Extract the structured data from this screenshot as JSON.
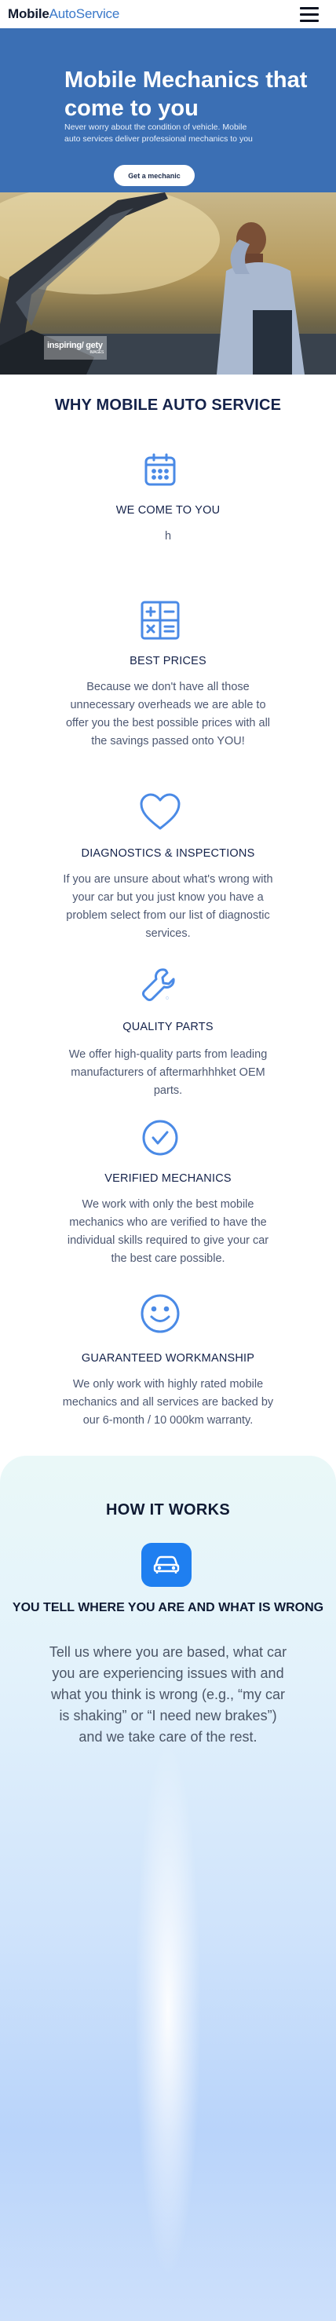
{
  "header": {
    "logo_part1": "Mobile",
    "logo_part2": "AutoService",
    "menu_icon": "hamburger-menu-icon"
  },
  "hero": {
    "title": "Mobile Mechanics that come to you",
    "subtitle": "Never worry about the condition of vehicle. Mobile auto services deliver professional mechanics to you",
    "cta_label": "Get a mechanic"
  },
  "photo": {
    "watermark_main": "inspiring/ gety",
    "watermark_sub": "IMAGES"
  },
  "why": {
    "title": "WHY MOBILE AUTO SERVICE",
    "features": [
      {
        "icon": "calendar-icon",
        "title": "WE COME TO YOU",
        "desc": "h"
      },
      {
        "icon": "calculator-icon",
        "title": "BEST PRICES",
        "desc": "Because we don't have all those unnecessary overheads we are able to offer you the best possible prices with all the savings passed onto YOU!"
      },
      {
        "icon": "heart-icon",
        "title": "DIAGNOSTICS & INSPECTIONS",
        "desc": "If you are unsure about what's wrong with your car but you just know you have a problem select from our list of diagnostic services."
      },
      {
        "icon": "wrench-icon",
        "title": "QUALITY PARTS",
        "desc": "We offer high-quality parts from leading manufacturers of aftermarhhhket OEM parts."
      },
      {
        "icon": "check-circle-icon",
        "title": "VERIFIED MECHANICS",
        "desc": "We work with only the best mobile mechanics who are verified to have the individual skills required to give your car the best care possible."
      },
      {
        "icon": "smile-icon",
        "title": "GUARANTEED WORKMANSHIP",
        "desc": "We only work with highly rated mobile mechanics and all services are backed by our 6-month / 10 000km warranty."
      }
    ]
  },
  "how": {
    "title": "HOW IT WORKS",
    "step_icon": "car-icon",
    "step_title": "YOU TELL WHERE YOU ARE AND WHAT IS WRONG",
    "step_desc": "Tell us where you are based, what car you are experiencing issues with and what you think is wrong (e.g., “my car is shaking” or “I need new brakes”) and we take care of the rest."
  },
  "colors": {
    "brand_blue": "#3b6fb4",
    "accent_blue": "#4a8ae6",
    "how_icon_bg": "#1f7ff0"
  }
}
